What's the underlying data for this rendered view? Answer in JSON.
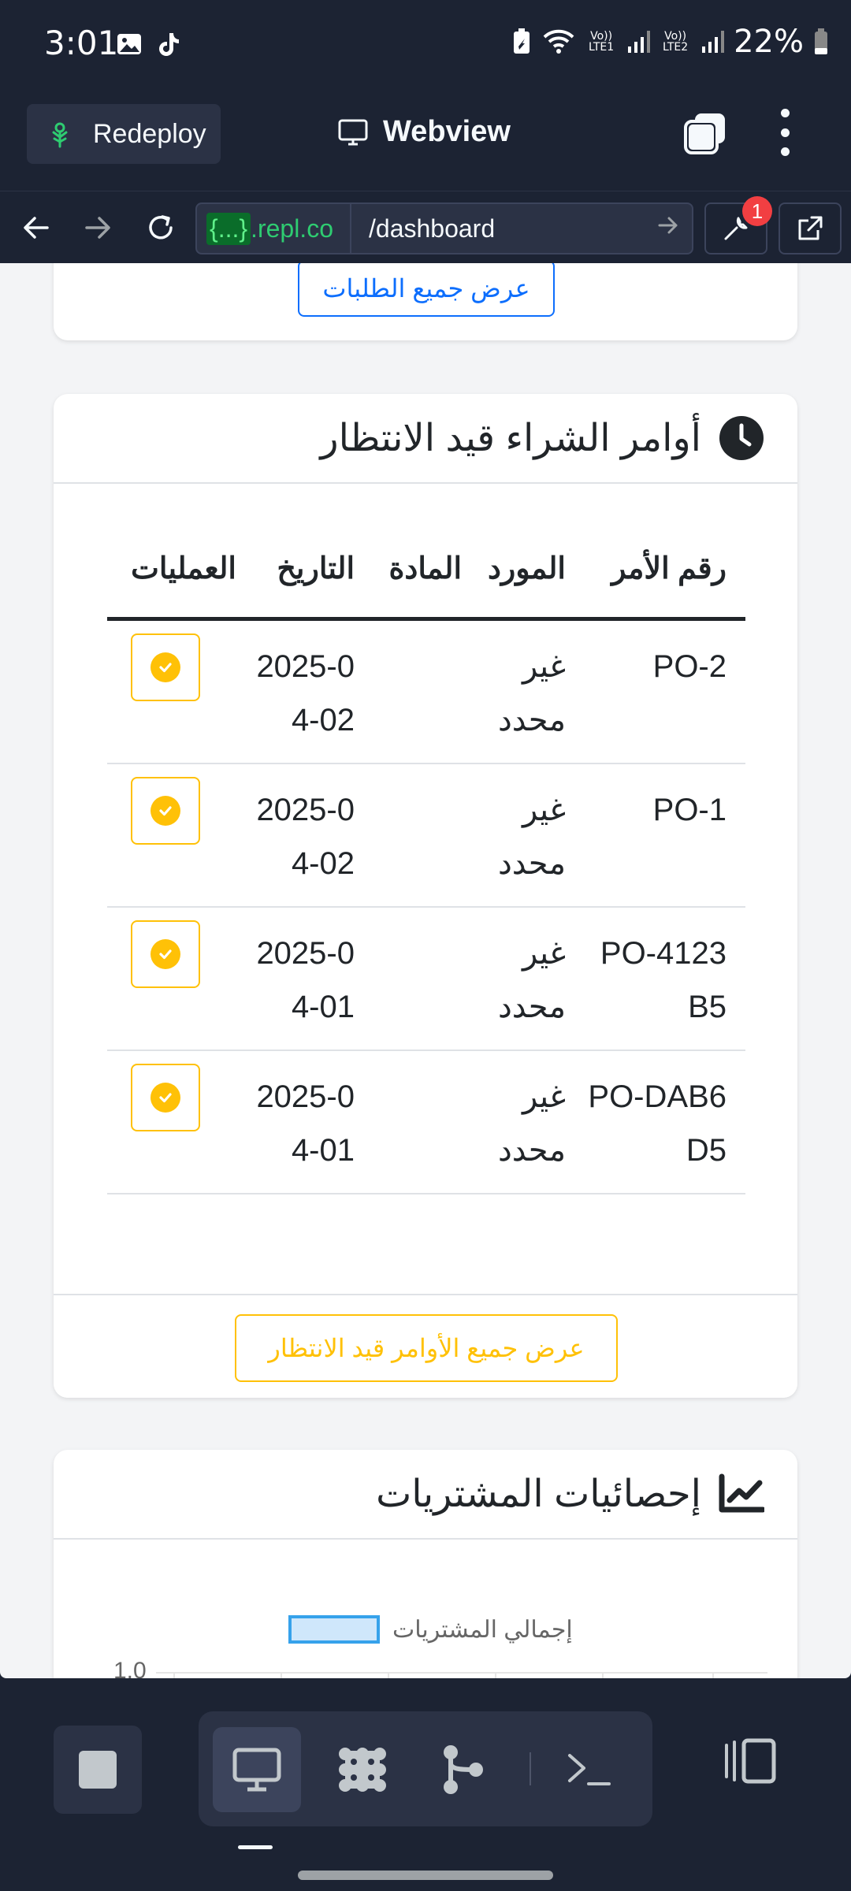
{
  "status_bar": {
    "time": "3:01",
    "network_1": "Vo)) LTE1",
    "network_2": "Vo)) LTE2",
    "battery": "22%"
  },
  "header": {
    "redeploy_label": "Redeploy",
    "title": "Webview"
  },
  "url_bar": {
    "host_brace": "{...}",
    "host_rest": ".repl.co",
    "path": "/dashboard",
    "devtools_badge": "1"
  },
  "requests_card": {
    "view_all_label": "عرض جميع الطلبات"
  },
  "pending_card": {
    "title": "أوامر الشراء قيد الانتظار",
    "columns": [
      "رقم الأمر",
      "المورد",
      "المادة",
      "التاريخ",
      "العمليات"
    ],
    "rows": [
      {
        "order": "PO-2",
        "supplier": "غير محدد",
        "item": "",
        "date": "2025-04-02"
      },
      {
        "order": "PO-1",
        "supplier": "غير محدد",
        "item": "",
        "date": "2025-04-02"
      },
      {
        "order": "PO-4123B5",
        "supplier": "غير محدد",
        "item": "",
        "date": "2025-04-01"
      },
      {
        "order": "PO-DAB6D5",
        "supplier": "غير محدد",
        "item": "",
        "date": "2025-04-01"
      }
    ],
    "view_all_label": "عرض جميع الأوامر قيد الانتظار"
  },
  "stats_card": {
    "title": "إحصائيات المشتريات",
    "chart_legend": "إجمالي المشتريات",
    "y_tick_top": "1.0"
  },
  "colors": {
    "primary": "#0d6efd",
    "warning": "#ffc107",
    "dark_ui": "#1c2333"
  }
}
